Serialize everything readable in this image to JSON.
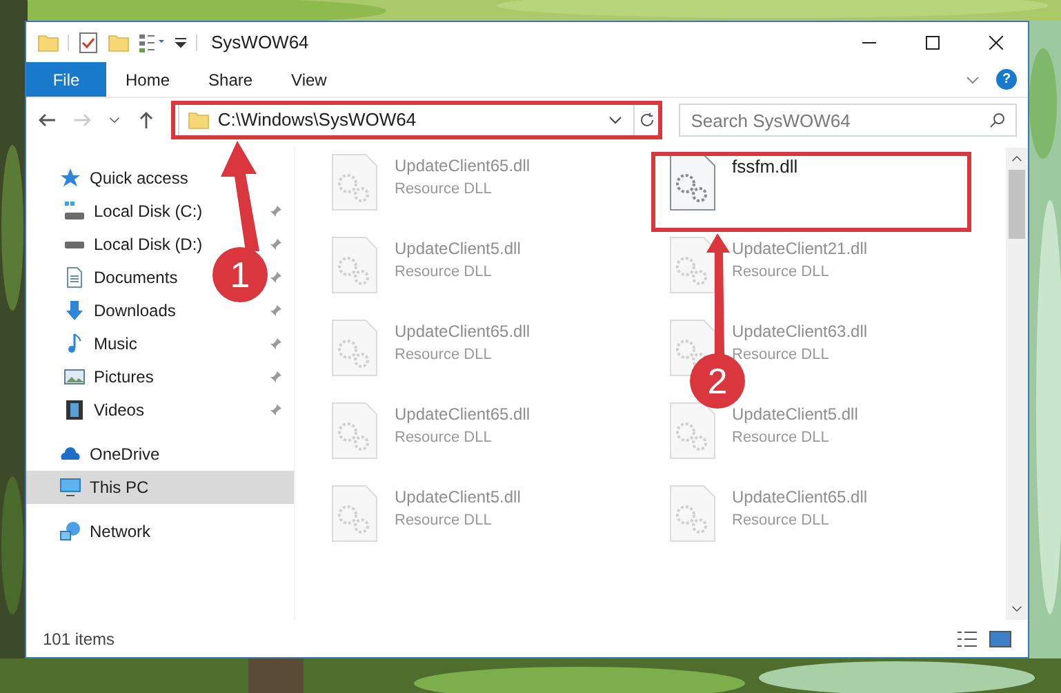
{
  "window": {
    "title": "SysWOW64"
  },
  "ribbon_tabs": [
    {
      "label": "File",
      "kind": "file"
    },
    {
      "label": "Home",
      "kind": "tab"
    },
    {
      "label": "Share",
      "kind": "tab"
    },
    {
      "label": "View",
      "kind": "tab"
    }
  ],
  "help": "?",
  "address_bar": {
    "path": "C:\\Windows\\SysWOW64"
  },
  "search": {
    "placeholder": "Search SysWOW64"
  },
  "sidebar": {
    "items": [
      {
        "label": "Quick access",
        "selected": false,
        "children": [
          {
            "label": "Local Disk (C:)"
          },
          {
            "label": "Local Disk (D:)"
          },
          {
            "label": "Documents"
          },
          {
            "label": "Downloads"
          },
          {
            "label": "Music"
          },
          {
            "label": "Pictures"
          },
          {
            "label": "Videos"
          }
        ]
      },
      {
        "label": "OneDrive",
        "selected": false
      },
      {
        "label": "This PC",
        "selected": true
      },
      {
        "label": "Network",
        "selected": false
      }
    ]
  },
  "files": [
    {
      "name": "UpdateClient65.dll",
      "type": "Resource DLL",
      "kind": "faded"
    },
    {
      "name": "fssfm.dll",
      "kind": "clear"
    },
    {
      "name": "UpdateClient5.dll",
      "type": "Resource DLL",
      "kind": "faded"
    },
    {
      "name": "UpdateClient21.dll",
      "type": "Resource DLL",
      "kind": "faded"
    },
    {
      "name": "UpdateClient65.dll",
      "type": "Resource DLL",
      "kind": "faded"
    },
    {
      "name": "UpdateClient63.dll",
      "type": "Resource DLL",
      "kind": "faded"
    },
    {
      "name": "UpdateClient65.dll",
      "type": "Resource DLL",
      "kind": "faded"
    },
    {
      "name": "UpdateClient5.dll",
      "type": "Resource DLL",
      "kind": "faded"
    },
    {
      "name": "UpdateClient5.dll",
      "type": "Resource DLL",
      "kind": "faded"
    },
    {
      "name": "UpdateClient65.dll",
      "type": "Resource DLL",
      "kind": "faded"
    }
  ],
  "status_bar": {
    "item_count": "101 items"
  },
  "annotations": [
    {
      "label": "1"
    },
    {
      "label": "2"
    }
  ]
}
